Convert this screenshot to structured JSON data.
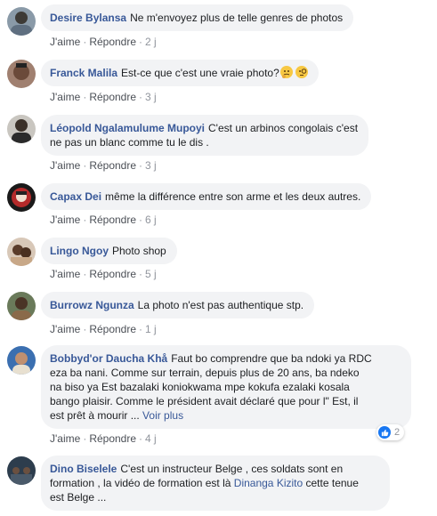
{
  "actions": {
    "like": "J'aime",
    "reply": "Répondre",
    "separator": "·"
  },
  "comments": [
    {
      "author": "Desire Bylansa",
      "text": "Ne m'envoyez plus de telle genres de photos",
      "time": "2 j"
    },
    {
      "author": "Franck Malila",
      "text": "Est-ce que c'est une vraie photo?",
      "time": "3 j",
      "emojis": [
        "thinking-face-emoji",
        "face-with-monocle-emoji"
      ]
    },
    {
      "author": "Léopold Ngalamulume Mupoyi",
      "text_line1": "C'est un arbinos congolais c'est",
      "text_line2": "ne pas un blanc comme tu le dis .",
      "time": "3 j"
    },
    {
      "author": "Capax Dei",
      "text": "même la différence entre son arme et les deux autres.",
      "time": "6 j"
    },
    {
      "author": "Lingo Ngoy",
      "text": "Photo shop",
      "time": "5 j"
    },
    {
      "author": "Burrowz Ngunza",
      "text": "La photo n'est pas authentique stp.",
      "time": "1 j"
    },
    {
      "author": "Bobbyd'or Daucha Khå",
      "lines": [
        "Faut bo comprendre que ba ndoki ya RDC",
        "eza ba nani. Comme sur terrain, depuis plus de 20 ans, ba ndeko",
        "na biso ya Est bazalaki koniokwama mpe kokufa ezalaki kosala",
        "bango plaisir. Comme le président avait déclaré que pour l\" Est, il",
        "est prêt à mourir ..."
      ],
      "see_more": "Voir plus",
      "time": "4 j",
      "reaction_count": "2"
    },
    {
      "author": "Dino Biselele",
      "line1": "C'est un instructeur Belge , ces soldats sont en",
      "line2_before": "formation , la vidéo de formation est là ",
      "mention": "Dinanga Kizito",
      "line2_after": " cette tenue",
      "line3": "est Belge ..."
    }
  ],
  "colors": {
    "link": "#385898",
    "bubble": "#f2f3f5",
    "meta": "#90949c",
    "like_blue": "#1877f2"
  }
}
